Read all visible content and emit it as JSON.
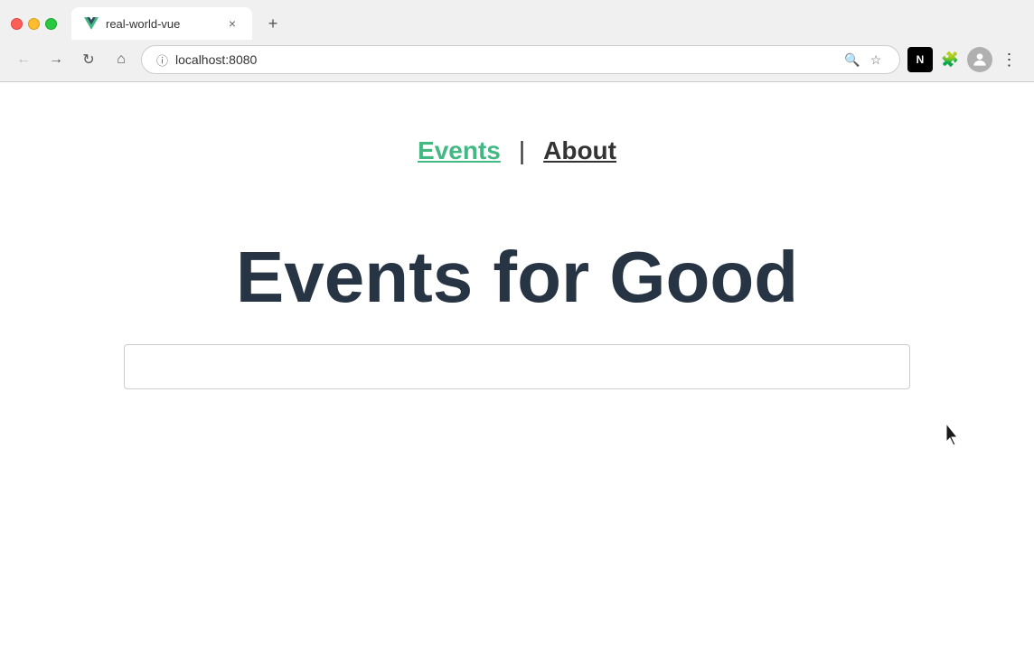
{
  "browser": {
    "tab": {
      "title": "real-world-vue",
      "close_label": "×"
    },
    "new_tab_label": "+",
    "address": "localhost:8080",
    "back_label": "←",
    "forward_label": "→",
    "reload_label": "↻",
    "home_label": "⌂"
  },
  "nav": {
    "events_label": "Events",
    "separator": "|",
    "about_label": "About"
  },
  "page": {
    "hero_title": "Events for Good"
  }
}
